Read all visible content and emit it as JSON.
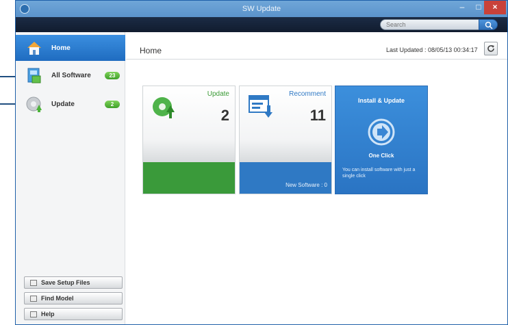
{
  "window": {
    "title": "SW Update",
    "minimize": "–",
    "maximize": "□",
    "close": "×"
  },
  "search": {
    "placeholder": "Search"
  },
  "sidebar": {
    "items": [
      {
        "label": "Home"
      },
      {
        "label": "All Software",
        "badge": "23"
      },
      {
        "label": "Update",
        "badge": "2"
      }
    ],
    "buttons": [
      {
        "label": "Save Setup Files"
      },
      {
        "label": "Find Model"
      },
      {
        "label": "Help"
      }
    ]
  },
  "header": {
    "title": "Home",
    "last_updated": "Last Updated : 08/05/13 00:34:17"
  },
  "tiles": {
    "update": {
      "label": "Update",
      "count": "2"
    },
    "recommend": {
      "label": "Recomment",
      "count": "11",
      "footer": "New Software : 0"
    },
    "install": {
      "title": "Install & Update",
      "caption": "One Click",
      "description": "You can install software with just a single click"
    }
  },
  "colors": {
    "accent": "#2f79c4",
    "update_green": "#3a9a3a",
    "titlebar": "#5b93cb",
    "toolbar": "#111c2f"
  }
}
